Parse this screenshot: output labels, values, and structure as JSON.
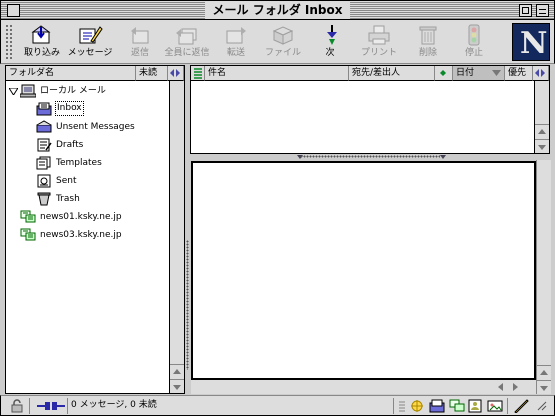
{
  "window": {
    "title": "メール フォルダ Inbox"
  },
  "toolbar": {
    "buttons": [
      {
        "label": "取り込み",
        "icon": "get-mail-icon",
        "enabled": true
      },
      {
        "label": "メッセージ",
        "icon": "new-message-icon",
        "enabled": true
      },
      {
        "label": "返信",
        "icon": "reply-icon",
        "enabled": false
      },
      {
        "label": "全員に返信",
        "icon": "reply-all-icon",
        "enabled": false
      },
      {
        "label": "転送",
        "icon": "forward-icon",
        "enabled": false
      },
      {
        "label": "ファイル",
        "icon": "file-icon",
        "enabled": false
      },
      {
        "label": "次",
        "icon": "next-icon",
        "enabled": true
      },
      {
        "label": "プリント",
        "icon": "print-icon",
        "enabled": false
      },
      {
        "label": "削除",
        "icon": "delete-icon",
        "enabled": false
      },
      {
        "label": "停止",
        "icon": "stop-icon",
        "enabled": false
      }
    ],
    "logo": "N"
  },
  "folder_pane": {
    "columns": {
      "name": "フォルダ名",
      "unread": "未読"
    },
    "root": {
      "label": "ローカル メール",
      "expanded": true
    },
    "folders": [
      {
        "label": "Inbox",
        "icon": "inbox-icon",
        "selected": true
      },
      {
        "label": "Unsent Messages",
        "icon": "unsent-icon",
        "selected": false
      },
      {
        "label": "Drafts",
        "icon": "drafts-icon",
        "selected": false
      },
      {
        "label": "Templates",
        "icon": "templates-icon",
        "selected": false
      },
      {
        "label": "Sent",
        "icon": "sent-icon",
        "selected": false
      },
      {
        "label": "Trash",
        "icon": "trash-icon",
        "selected": false
      }
    ],
    "servers": [
      {
        "label": "news01.ksky.ne.jp",
        "icon": "news-server-icon"
      },
      {
        "label": "news03.ksky.ne.jp",
        "icon": "news-server-icon"
      }
    ]
  },
  "message_list": {
    "columns": {
      "subject": "件名",
      "sender": "宛先/差出人",
      "date": "日付",
      "priority": "優先"
    },
    "rows": []
  },
  "status": {
    "text": "0 メッセージ, 0 未読"
  },
  "colors": {
    "window_bg": "#cccccc",
    "logo_bg": "#13295e",
    "accent_green": "#0a8a2a"
  }
}
